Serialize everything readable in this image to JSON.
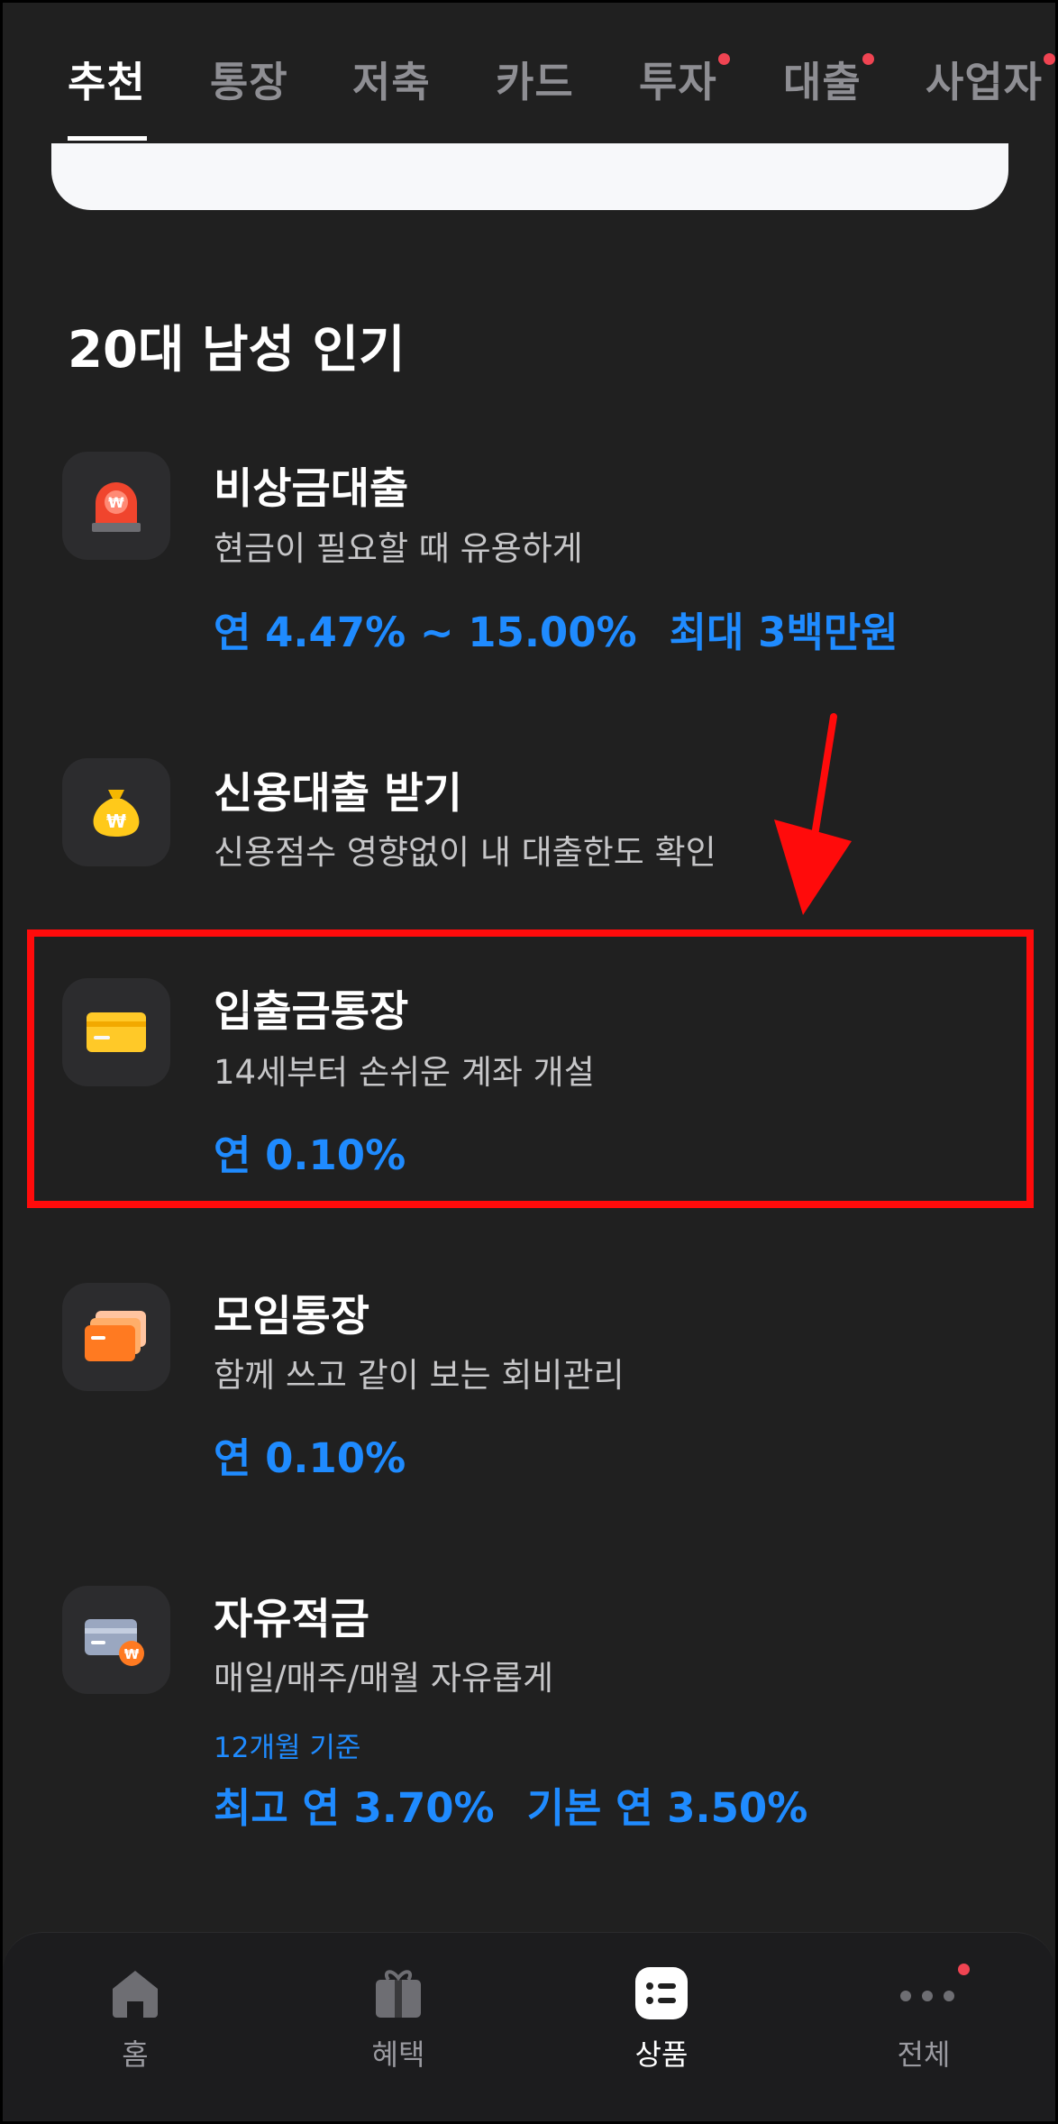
{
  "tabs": [
    {
      "label": "추천",
      "active": true,
      "dot": false
    },
    {
      "label": "통장",
      "active": false,
      "dot": false
    },
    {
      "label": "저축",
      "active": false,
      "dot": false
    },
    {
      "label": "카드",
      "active": false,
      "dot": false
    },
    {
      "label": "투자",
      "active": false,
      "dot": true
    },
    {
      "label": "대출",
      "active": false,
      "dot": true
    },
    {
      "label": "사업자",
      "active": false,
      "dot": true
    }
  ],
  "section_title": "20대 남성 인기",
  "products": [
    {
      "title": "비상금대출",
      "desc": "현금이 필요할 때 유용하게",
      "rate": "연 4.47% ~ 15.00%",
      "rate2": "최대 3백만원",
      "icon": "siren-icon"
    },
    {
      "title": "신용대출 받기",
      "desc": "신용점수 영향없이 내 대출한도 확인",
      "icon": "money-bag-icon"
    },
    {
      "title": "입출금통장",
      "desc": "14세부터 손쉬운 계좌 개설",
      "rate": "연 0.10%",
      "icon": "yellow-card-icon"
    },
    {
      "title": "모임통장",
      "desc": "함께 쓰고 같이 보는 회비관리",
      "rate": "연 0.10%",
      "icon": "orange-cards-icon"
    },
    {
      "title": "자유적금",
      "desc": "매일/매주/매월 자유롭게",
      "sub": "12개월 기준",
      "rate": "최고 연 3.70%",
      "rate2": "기본 연 3.50%",
      "icon": "savings-card-icon"
    }
  ],
  "bottom_nav": [
    {
      "label": "홈",
      "icon": "home-icon",
      "active": false
    },
    {
      "label": "혜택",
      "icon": "gift-icon",
      "active": false
    },
    {
      "label": "상품",
      "icon": "products-list-icon",
      "active": true
    },
    {
      "label": "전체",
      "icon": "more-dots-icon",
      "active": false,
      "dot": true
    }
  ],
  "colors": {
    "background": "#202020",
    "accent_blue": "#1f8bff",
    "highlight_red": "#ff0b0b",
    "notification_dot": "#f04452"
  }
}
